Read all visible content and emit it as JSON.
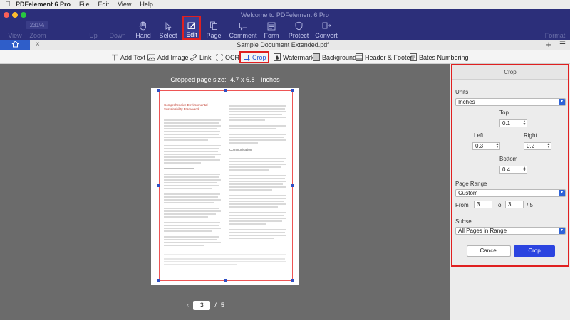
{
  "menubar": {
    "app_name": "PDFelement 6 Pro",
    "items": [
      "File",
      "Edit",
      "View",
      "Help"
    ]
  },
  "window": {
    "title": "Welcome to PDFelement 6 Pro"
  },
  "toolbar": {
    "zoom": "231%",
    "view_label": "View",
    "zoom_label": "Zoom",
    "up_label": "Up",
    "down_label": "Down",
    "hand_label": "Hand",
    "select_label": "Select",
    "edit_label": "Edit",
    "page_label": "Page",
    "comment_label": "Comment",
    "form_label": "Form",
    "protect_label": "Protect",
    "convert_label": "Convert",
    "format_label": "Format"
  },
  "tabs": {
    "document_title": "Sample Document Extended.pdf"
  },
  "edit_toolbar": {
    "add_text": "Add Text",
    "add_image": "Add Image",
    "link": "Link",
    "ocr": "OCR",
    "crop": "Crop",
    "watermark": "Watermark",
    "background": "Background",
    "header_footer": "Header & Footer",
    "bates_numbering": "Bates Numbering"
  },
  "document": {
    "cropped_size_label": "Cropped page size:",
    "cropped_size_value": "4.7 x 6.8",
    "cropped_size_unit": "Inches",
    "page_heading_1": "Comprehensive Environmental Sustainability Framework",
    "page_heading_2": "Communication",
    "current_page": "3",
    "page_separator": "/",
    "total_pages": "5"
  },
  "crop_panel": {
    "title": "Crop",
    "units_label": "Units",
    "units_value": "Inches",
    "top_label": "Top",
    "top_value": "0.1",
    "left_label": "Left",
    "left_value": "0.3",
    "right_label": "Right",
    "right_value": "0.2",
    "bottom_label": "Bottom",
    "bottom_value": "0.4",
    "page_range_label": "Page Range",
    "page_range_value": "Custom",
    "from_label": "From",
    "from_value": "3",
    "to_label": "To",
    "to_value": "3",
    "of_total": "/ 5",
    "subset_label": "Subset",
    "subset_value": "All Pages in Range",
    "cancel_button": "Cancel",
    "crop_button": "Crop"
  },
  "colors": {
    "toolbar_bg": "#2c2f7a",
    "highlight_red": "#e02020",
    "accent_blue": "#2b44e0",
    "doc_bg": "#6b6b6b"
  }
}
